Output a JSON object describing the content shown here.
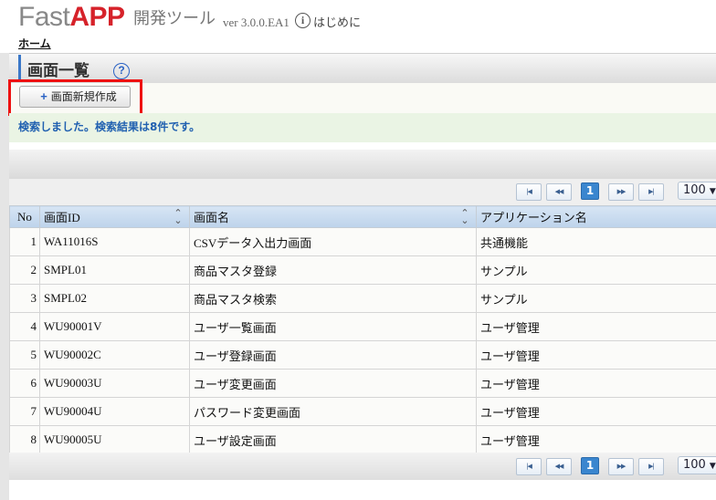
{
  "header": {
    "logo_fast": "Fast",
    "logo_app": "APP",
    "tool_name": "開発ツール",
    "version": "ver 3.0.0.EA1",
    "intro_icon": "info-icon",
    "intro_label": "はじめに"
  },
  "breadcrumb": {
    "home": "ホーム"
  },
  "page": {
    "title": "画面一覧",
    "help_icon": "question-mark-icon",
    "new_button_label": "画面新規作成",
    "message": "検索しました。検索結果は8件です。"
  },
  "pager": {
    "first": "◀◀",
    "prev": "◀◀",
    "current_page": "1",
    "next": "▶▶",
    "last": "▶▶",
    "page_size": "100"
  },
  "table": {
    "headers": {
      "no": "No",
      "screen_id": "画面ID",
      "screen_name": "画面名",
      "app_name": "アプリケーション名"
    },
    "rows": [
      {
        "no": "1",
        "id": "WA11016S",
        "name": "CSVデータ入出力画面",
        "app": "共通機能"
      },
      {
        "no": "2",
        "id": "SMPL01",
        "name": "商品マスタ登録",
        "app": "サンプル"
      },
      {
        "no": "3",
        "id": "SMPL02",
        "name": "商品マスタ検索",
        "app": "サンプル"
      },
      {
        "no": "4",
        "id": "WU90001V",
        "name": "ユーザ一覧画面",
        "app": "ユーザ管理"
      },
      {
        "no": "5",
        "id": "WU90002C",
        "name": "ユーザ登録画面",
        "app": "ユーザ管理"
      },
      {
        "no": "6",
        "id": "WU90003U",
        "name": "ユーザ変更画面",
        "app": "ユーザ管理"
      },
      {
        "no": "7",
        "id": "WU90004U",
        "name": "パスワード変更画面",
        "app": "ユーザ管理"
      },
      {
        "no": "8",
        "id": "WU90005U",
        "name": "ユーザ設定画面",
        "app": "ユーザ管理"
      }
    ]
  },
  "colors": {
    "brand_red": "#d6222a",
    "highlight": "#ee1111",
    "accent_blue": "#2a62c4",
    "message_text": "#2060b0"
  }
}
